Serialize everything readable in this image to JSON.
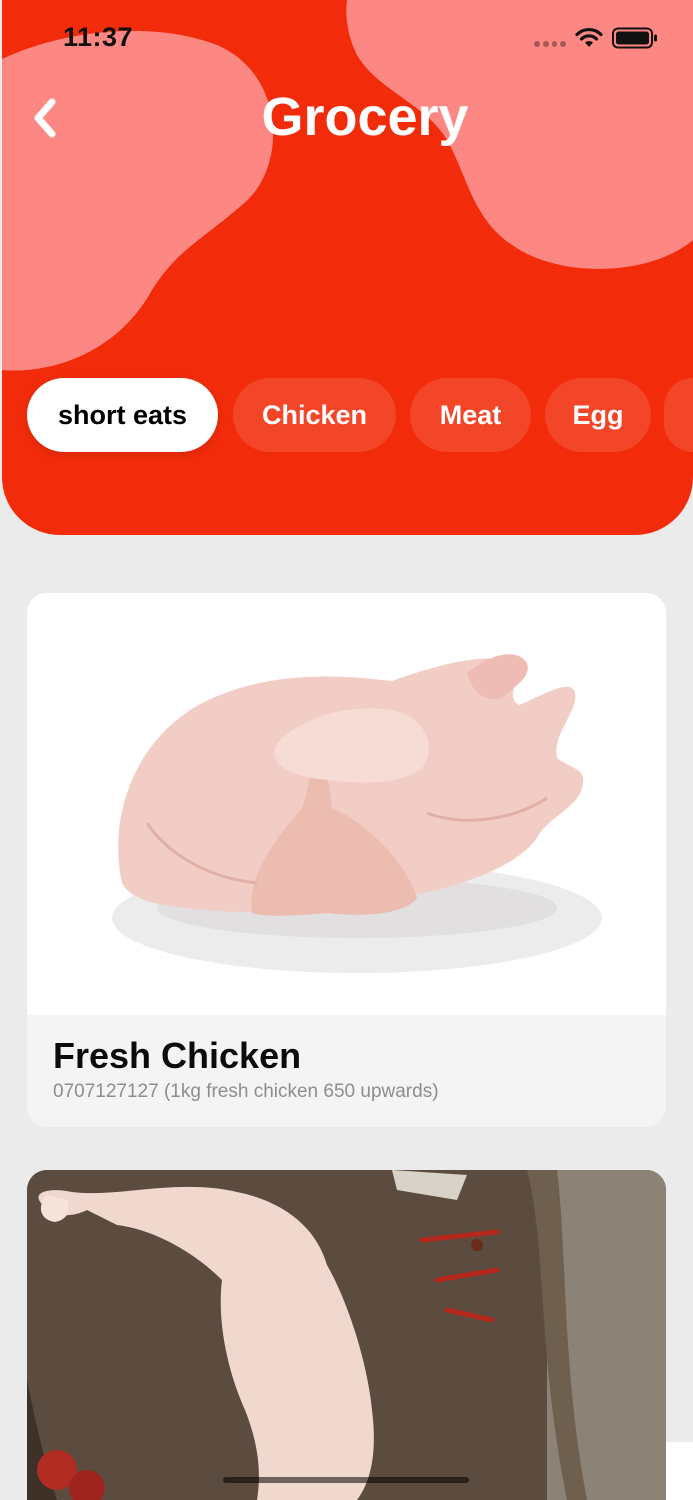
{
  "status_bar": {
    "time": "11:37"
  },
  "header": {
    "title": "Grocery",
    "back_icon": "chevron-left-icon",
    "background_color": "#f22c0b",
    "blob_color": "#fd8883"
  },
  "categories": [
    {
      "label": "short eats",
      "selected": true
    },
    {
      "label": "Chicken",
      "selected": false
    },
    {
      "label": "Meat",
      "selected": false
    },
    {
      "label": "Egg",
      "selected": false
    }
  ],
  "products": [
    {
      "title": "Fresh Chicken",
      "subtitle": "0707127127 (1kg fresh chicken 650 upwards)"
    },
    {
      "title": "",
      "subtitle": ""
    }
  ]
}
